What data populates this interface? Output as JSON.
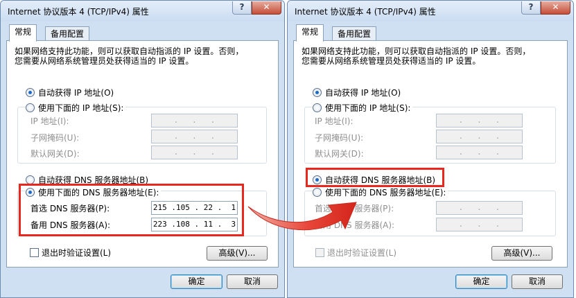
{
  "dialog_title": "Internet 协议版本 4 (TCP/IPv4) 属性",
  "help_symbol": "?",
  "close_symbol": "✕",
  "tabs": {
    "general": "常规",
    "alternate": "备用配置"
  },
  "description": [
    "如果网络支持此功能，则可以获取自动指派的 IP 设置。否则，",
    "您需要从网络系统管理员处获得适当的 IP 设置。"
  ],
  "ip_section": {
    "auto_ip": "自动获得 IP 地址(O)",
    "manual_ip": "使用下面的 IP 地址(S):",
    "ip_address": "IP 地址(I):",
    "subnet_mask": "子网掩码(U):",
    "gateway": "默认网关(D):"
  },
  "dns_section": {
    "auto_dns": "自动获得 DNS 服务器地址(B)",
    "manual_dns": "使用下面的 DNS 服务器地址(E):",
    "preferred_dns": "首选 DNS 服务器(P):",
    "alternate_dns": "备用 DNS 服务器(A):"
  },
  "empty_ip": " .   .   . ",
  "left_dns": {
    "preferred": "215 .105 . 22 .  1",
    "alternate": "223 .108 . 11 .  3"
  },
  "validate_on_exit": "退出时验证设置(L)",
  "advanced_button": "高级(V)...",
  "ok_button": "确定",
  "cancel_button": "取消",
  "colors": {
    "highlight": "#e8271e",
    "dialog_bg": "#cfe0f3",
    "radio_accent": "#1c6ac6"
  }
}
